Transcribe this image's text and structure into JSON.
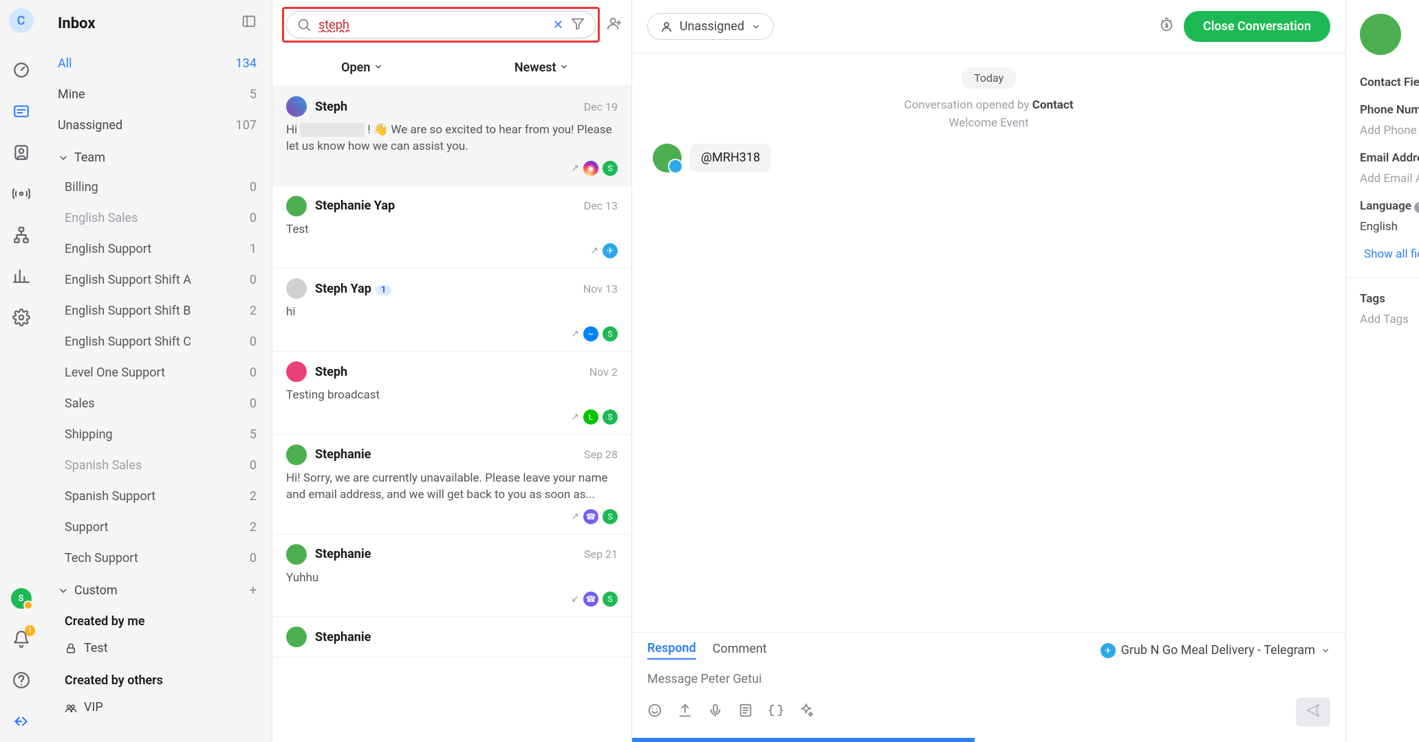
{
  "inbox": {
    "title": "Inbox",
    "items": [
      {
        "label": "All",
        "count": "134",
        "selected": true
      },
      {
        "label": "Mine",
        "count": "5"
      },
      {
        "label": "Unassigned",
        "count": "107"
      }
    ],
    "team_section": "Team",
    "team": [
      {
        "label": "Billing",
        "count": "0"
      },
      {
        "label": "English Sales",
        "count": "0",
        "muted": true
      },
      {
        "label": "English Support",
        "count": "1"
      },
      {
        "label": "English Support Shift A",
        "count": "0"
      },
      {
        "label": "English Support Shift B",
        "count": "2"
      },
      {
        "label": "English Support Shift C",
        "count": "0"
      },
      {
        "label": "Level One Support",
        "count": "0"
      },
      {
        "label": "Sales",
        "count": "0"
      },
      {
        "label": "Shipping",
        "count": "5"
      },
      {
        "label": "Spanish Sales",
        "count": "0",
        "muted": true
      },
      {
        "label": "Spanish Support",
        "count": "2"
      },
      {
        "label": "Support",
        "count": "2"
      },
      {
        "label": "Tech Support",
        "count": "0"
      }
    ],
    "custom_section": "Custom",
    "created_by_me": "Created by me",
    "test": "Test",
    "created_by_others": "Created by others",
    "vip": "VIP"
  },
  "workspace_initial": "C",
  "agent_initial": "S",
  "notif_count": "1",
  "search": {
    "value": "steph"
  },
  "tabs": {
    "open": "Open",
    "newest": "Newest"
  },
  "conversations": [
    {
      "name": "Steph",
      "date": "Dec 19",
      "preview_pre": "Hi ",
      "preview_redact": "",
      "preview_post": " ! 👋 We are so excited to hear from you! Please let us know how we can assist you.",
      "av": "photo",
      "arrow": "↗",
      "chan": "ig",
      "asg": "S",
      "selected": true
    },
    {
      "name": "Stephanie Yap",
      "date": "Dec 13",
      "preview": "Test",
      "av": "green",
      "arrow": "↗",
      "chan": "tg"
    },
    {
      "name": "Steph Yap",
      "date": "Nov 13",
      "preview": "hi",
      "av": "grey",
      "unread": "1",
      "arrow": "↗",
      "chan": "fb",
      "asg": "S"
    },
    {
      "name": "Steph",
      "date": "Nov 2",
      "preview": "Testing broadcast",
      "av": "pink",
      "arrow": "↗",
      "chan": "line",
      "asg": "S"
    },
    {
      "name": "Stephanie",
      "date": "Sep 28",
      "preview": "Hi! Sorry, we are currently unavailable. Please leave your name and email address, and we will get back to you as soon as...",
      "av": "green",
      "arrow": "↗",
      "chan": "viber",
      "asg": "S"
    },
    {
      "name": "Stephanie",
      "date": "Sep 21",
      "preview": "Yuhhu",
      "av": "green",
      "arrow": "↙",
      "chan": "viber",
      "asg": "S"
    },
    {
      "name": "Stephanie",
      "date": "",
      "preview": "",
      "av": "green"
    }
  ],
  "thread": {
    "assign": "Unassigned",
    "close": "Close Conversation",
    "today": "Today",
    "opened_pre": "Conversation opened by ",
    "opened_b": "Contact",
    "welcome": "Welcome Event",
    "msg": "@MRH318"
  },
  "composer": {
    "respond": "Respond",
    "comment": "Comment",
    "channel": "Grub N Go Meal Delivery - Telegram",
    "placeholder": "Message Peter Getui"
  },
  "side": {
    "contact_fields": "Contact Fields",
    "phone_label": "Phone Number",
    "phone_val": "Add Phone Number",
    "email_label": "Email Address",
    "email_val": "Add Email Address",
    "lang_label": "Language",
    "lang_val": "English",
    "show_all": "Show all fields",
    "tags": "Tags",
    "add_tags": "Add Tags"
  }
}
